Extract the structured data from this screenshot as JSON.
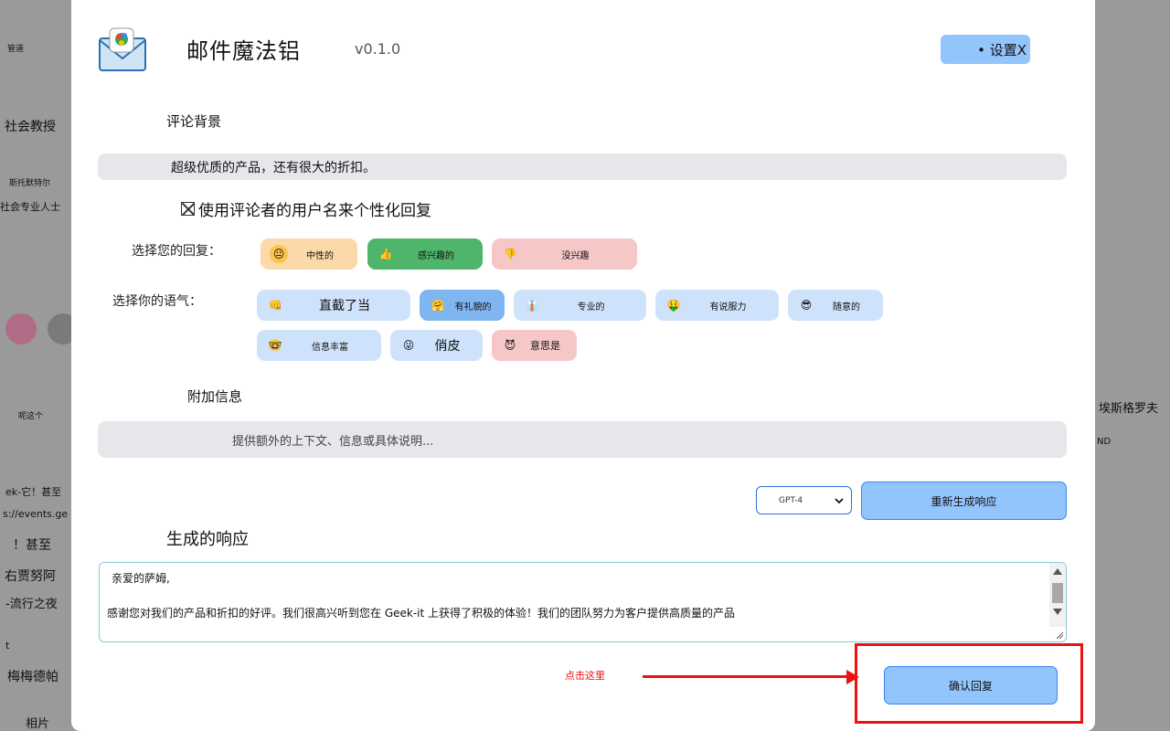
{
  "background": {
    "left_items": [
      "管道",
      "社会教授",
      "斯托默特尔",
      "社会专业人士",
      "呢这个",
      "ek-它！甚至",
      "s://events.ge",
      "！甚至",
      "右贾努阿",
      "-流行之夜",
      "t",
      "梅梅德帕",
      "相片"
    ],
    "right_items": [
      "埃斯格罗夫",
      "ND"
    ]
  },
  "app": {
    "title": "邮件魔法铝",
    "version": "v0.1.0",
    "settings_label": "• 设置X"
  },
  "review_background": {
    "label": "评论背景",
    "value": "超级优质的产品，还有很大的折扣。"
  },
  "personalize": {
    "label": "使用评论者的用户名来个性化回复"
  },
  "reply_choice": {
    "label": "选择您的回复：",
    "options": [
      {
        "label": "中性的",
        "icon": "neutral-face-icon",
        "color": "#fcd9a8",
        "emoji": "😐"
      },
      {
        "label": "感兴趣的",
        "icon": "thumbs-up-icon",
        "color": "#4fb56a",
        "emoji": "👍"
      },
      {
        "label": "没兴趣",
        "icon": "thumbs-down-icon",
        "color": "#f6c7c7",
        "emoji": "👎"
      }
    ]
  },
  "tone_choice": {
    "label": "选择你的语气：",
    "options": [
      {
        "label": "直截了当",
        "icon": "fist-icon",
        "color": "#cfe2fb",
        "emoji": "👊"
      },
      {
        "label": "有礼貌的",
        "icon": "hug-face-icon",
        "color": "#7fb6f2",
        "emoji": "🤗"
      },
      {
        "label": "专业的",
        "icon": "suit-icon",
        "color": "#cfe2fb",
        "emoji": "👔"
      },
      {
        "label": "有说服力",
        "icon": "money-face-icon",
        "color": "#cfe2fb",
        "emoji": "🤑"
      },
      {
        "label": "随意的",
        "icon": "sunglasses-face-icon",
        "color": "#cfe2fb",
        "emoji": "😎"
      },
      {
        "label": "信息丰富",
        "icon": "nerd-face-icon",
        "color": "#cfe2fb",
        "emoji": "🤓"
      },
      {
        "label": "俏皮",
        "icon": "tongue-face-icon",
        "color": "#cfe2fb",
        "emoji": "😜"
      },
      {
        "label": "意思是",
        "icon": "devil-face-icon",
        "color": "#f6c7c7",
        "emoji": "😈"
      }
    ]
  },
  "additional_info": {
    "label": "附加信息",
    "placeholder": "提供额外的上下文、信息或具体说明..."
  },
  "model_select": {
    "value": "GPT-4"
  },
  "regenerate_label": "重新生成响应",
  "generated": {
    "label": "生成的响应",
    "lines": [
      "亲爱的萨姆,",
      "感谢您对我们的产品和折扣的好评。我们很高兴听到您在 Geek-it 上获得了积极的体验！我们的团队努力为客户提供高质量的产品"
    ]
  },
  "annotation": {
    "hint": "点击这里",
    "color": "#e11111"
  },
  "confirm_label": "确认回复"
}
